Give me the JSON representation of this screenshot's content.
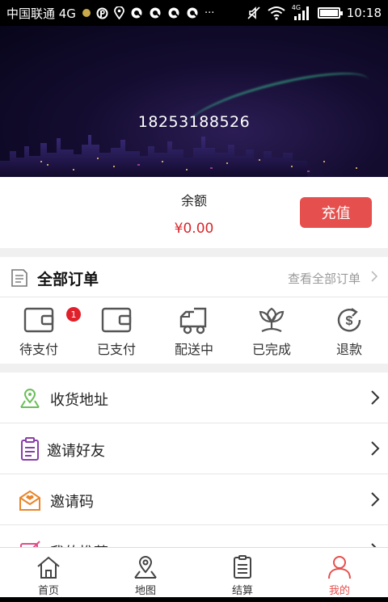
{
  "status_bar": {
    "carrier": "中国联通 4G",
    "time": "10:18",
    "icons": [
      "notification-dot",
      "p-icon",
      "location-icon",
      "q-icon",
      "q-icon",
      "q-icon",
      "q-icon",
      "more-icon",
      "mute-icon",
      "wifi-icon",
      "signal-icon",
      "battery-icon"
    ],
    "more_glyph": "···",
    "network_label": "4G"
  },
  "profile": {
    "phone": "18253188526"
  },
  "balance": {
    "label": "余额",
    "amount": "¥0.00",
    "recharge_label": "充值"
  },
  "orders": {
    "title": "全部订单",
    "view_all": "查看全部订单",
    "items": [
      {
        "label": "待支付",
        "icon": "wallet-icon",
        "badge": "1"
      },
      {
        "label": "已支付",
        "icon": "wallet-icon"
      },
      {
        "label": "配送中",
        "icon": "truck-icon"
      },
      {
        "label": "已完成",
        "icon": "flower-icon"
      },
      {
        "label": "退款",
        "icon": "refund-icon"
      }
    ]
  },
  "menu": {
    "items": [
      {
        "label": "收货地址",
        "icon": "location-pin-icon",
        "color": "#6cbf5a"
      },
      {
        "label": "邀请好友",
        "icon": "clipboard-icon",
        "color": "#8a3fa8"
      },
      {
        "label": "邀请码",
        "icon": "envelope-heart-icon",
        "color": "#e9862a"
      },
      {
        "label": "我的推荐",
        "icon": "edit-icon",
        "color": "#e04c8a"
      }
    ]
  },
  "tabbar": {
    "items": [
      {
        "label": "首页",
        "icon": "home-icon"
      },
      {
        "label": "地图",
        "icon": "map-icon"
      },
      {
        "label": "结算",
        "icon": "receipt-icon"
      },
      {
        "label": "我的",
        "icon": "user-icon",
        "active": true
      }
    ]
  },
  "colors": {
    "accent": "#e5504e",
    "price": "#d8272b"
  }
}
